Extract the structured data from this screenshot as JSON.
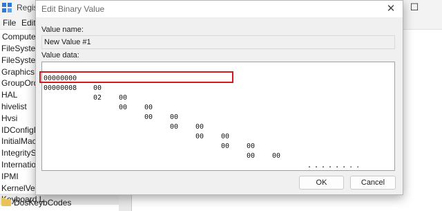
{
  "regedit": {
    "title": "Regis",
    "menu": [
      "File",
      "Edit"
    ],
    "address": "Computer",
    "tree_items": [
      "FileSystem",
      "FileSystem",
      "GraphicsDr",
      "GroupOrde",
      "HAL",
      "hivelist",
      "Hvsi",
      "IDConfigD",
      "InitialMach",
      "IntegritySe",
      "Internation",
      "IPMI",
      "KernelVelo",
      "Keyboard L",
      "DosKeybCodes"
    ],
    "selected_index": 13
  },
  "dialog": {
    "title": "Edit Binary Value",
    "close_glyph": "✕",
    "value_name_label": "Value name:",
    "value_name": "New Value #1",
    "value_data_label": "Value data:",
    "hex_rows": [
      {
        "address": "00000000",
        "bytes": [
          "00",
          "00",
          "00",
          "00",
          "00",
          "00",
          "00",
          "00"
        ],
        "ascii": "........"
      },
      {
        "address": "00000008",
        "bytes": [
          "02",
          "00",
          "00",
          "00",
          "00",
          "00",
          "00"
        ],
        "ascii": "......"
      }
    ],
    "ok_label": "OK",
    "cancel_label": "Cancel",
    "highlight_color": "#d4181f"
  },
  "colors": {
    "window_bg": "#f0f0f0",
    "highlight": "#d4181f",
    "folder": "#e8c35a"
  },
  "icons": [
    "registry-app-icon",
    "close-icon",
    "minimize-icon",
    "maximize-icon",
    "folder-icon"
  ]
}
